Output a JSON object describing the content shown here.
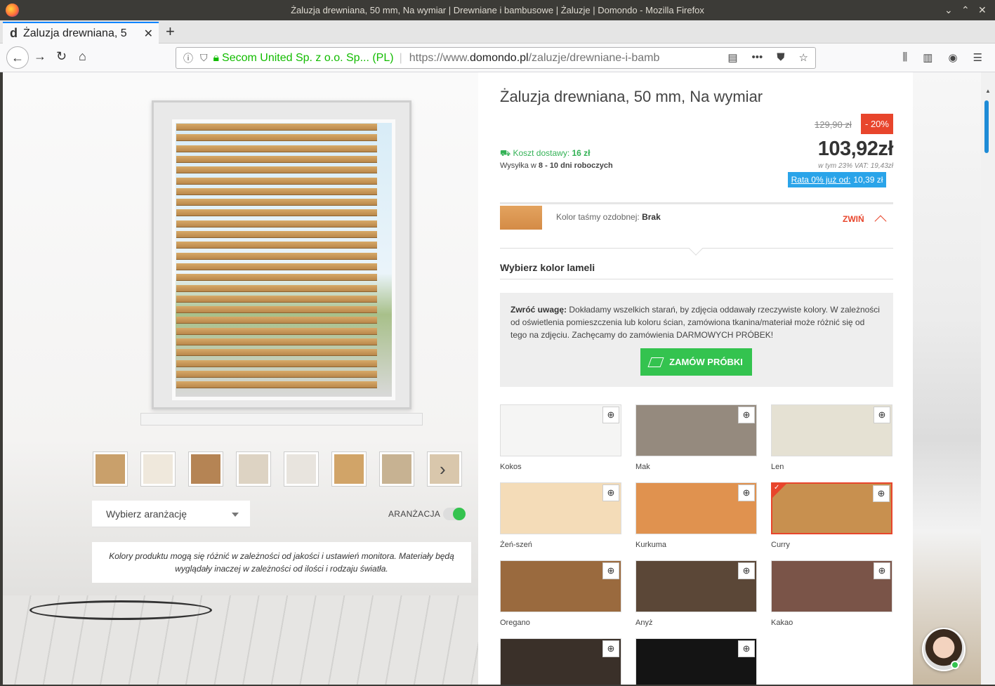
{
  "window": {
    "title": "Żaluzja drewniana, 50 mm, Na wymiar | Drewniane i bambusowe | Żaluzje | Domondo - Mozilla Firefox"
  },
  "tab": {
    "title": "Żaluzja drewniana, 5",
    "favicon": "d"
  },
  "urlbar": {
    "security_owner": "Secom United Sp. z o.o. Sp... (PL)",
    "url_prefix": "https://www.",
    "url_domain": "domondo.pl",
    "url_path": "/zaluzje/drewniane-i-bamb"
  },
  "gallery": {
    "arrangement_placeholder": "Wybierz aranżację",
    "arrangement_label": "ARANŻACJA",
    "arrangement_on": true,
    "disclaimer": "Kolory produktu mogą się różnić w zależności od jakości i ustawień monitora. Materiały będą wyglądały inaczej w zależności od ilości i rodzaju światła."
  },
  "product": {
    "title": "Żaluzja drewniana, 50 mm, Na wymiar",
    "old_price": "129,90 zł",
    "discount": "- 20%",
    "delivery_label": "Koszt dostawy:",
    "delivery_value": "16 zł",
    "shipping_prefix": "Wysyłka w",
    "shipping_days": "8 - 10 dni roboczych",
    "price": "103,92zł",
    "vat": "w tym 23% VAT: 19,43zł",
    "installment_link": "Rata 0% już od:",
    "installment_value": "10,39 zł"
  },
  "tape": {
    "label": "Kolor taśmy ozdobnej:",
    "value": "Brak",
    "collapse": "ZWIŃ"
  },
  "colors": {
    "heading": "Wybierz kolor lameli",
    "warning_title": "Zwróć uwagę:",
    "warning_text": "Dokładamy wszelkich starań, by zdjęcia oddawały rzeczywiste kolory. W zależności od oświetlenia pomieszczenia lub koloru ścian, zamówiona tkanina/materiał może różnić się od tego na zdjęciu. Zachęcamy do zamówienia DARMOWYCH PRÓBEK!",
    "samples_button": "ZAMÓW PRÓBKI",
    "selected": "Curry",
    "items": [
      {
        "name": "Kokos",
        "color": "#f5f5f4"
      },
      {
        "name": "Mak",
        "color": "#958a7e"
      },
      {
        "name": "Len",
        "color": "#e5e1d3"
      },
      {
        "name": "Żeń-szeń",
        "color": "#f4dcb8"
      },
      {
        "name": "Kurkuma",
        "color": "#e0924f"
      },
      {
        "name": "Curry",
        "color": "#c8904f"
      },
      {
        "name": "Oregano",
        "color": "#9a6a3e"
      },
      {
        "name": "Anyż",
        "color": "#5b4737"
      },
      {
        "name": "Kakao",
        "color": "#7a5448"
      },
      {
        "name": "",
        "color": "#3a3029"
      },
      {
        "name": "",
        "color": "#141414"
      }
    ]
  }
}
